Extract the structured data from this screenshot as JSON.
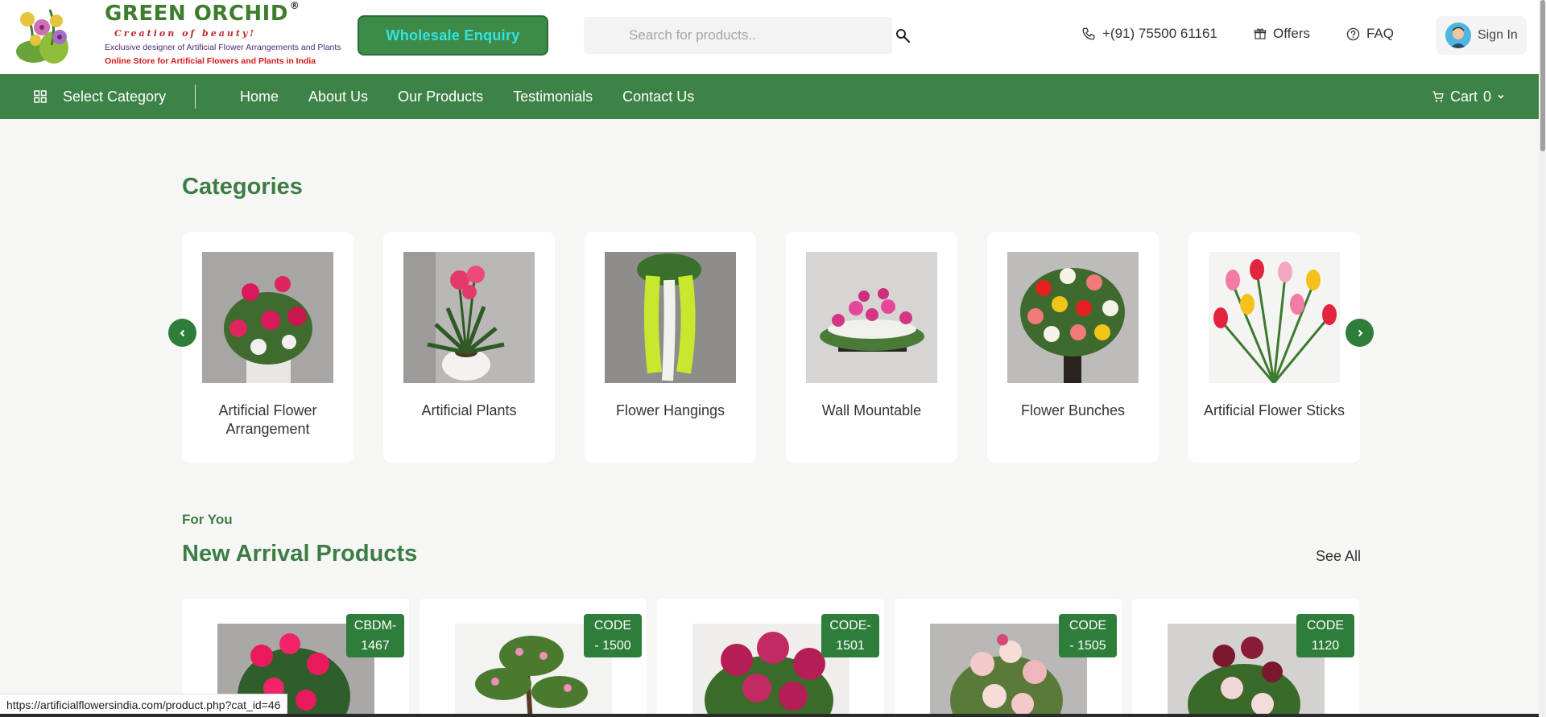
{
  "header": {
    "brand": "GREEN ORCHID",
    "registered": "®",
    "tagline": "Creation of beauty!",
    "sub1": "Exclusive designer of Artificial Flower Arrangements and Plants",
    "sub2": "Online Store for Artificial Flowers and Plants in India",
    "wholesale_label": "Wholesale Enquiry",
    "search_placeholder": "Search for products..",
    "phone": "+(91) 75500 61161",
    "offers": "Offers",
    "faq": "FAQ",
    "signin": "Sign In"
  },
  "nav": {
    "select_category": "Select Category",
    "links": [
      "Home",
      "About Us",
      "Our Products",
      "Testimonials",
      "Contact Us"
    ],
    "cart_label": "Cart",
    "cart_count": "0"
  },
  "categories": {
    "title": "Categories",
    "items": [
      {
        "name": "Artificial Flower Arrangement"
      },
      {
        "name": "Artificial Plants"
      },
      {
        "name": "Flower Hangings"
      },
      {
        "name": "Wall Mountable"
      },
      {
        "name": "Flower Bunches"
      },
      {
        "name": "Artificial Flower Sticks"
      }
    ]
  },
  "new_arrivals": {
    "eyebrow": "For You",
    "title": "New Arrival Products",
    "see_all": "See All",
    "products": [
      {
        "code_line1": "CBDM-",
        "code_line2": "1467"
      },
      {
        "code_line1": "CODE",
        "code_line2": "- 1500"
      },
      {
        "code_line1": "CODE-",
        "code_line2": "1501"
      },
      {
        "code_line1": "CODE",
        "code_line2": "- 1505"
      },
      {
        "code_line1": "CODE",
        "code_line2": "1120"
      }
    ]
  },
  "status_bar": {
    "url": "https://artificialflowersindia.com/product.php?cat_id=46"
  },
  "colors": {
    "brand_green": "#3d8246",
    "heading_green": "#3d7d45",
    "badge_green": "#2e7d3a",
    "wholesale_text": "#35e3e0"
  }
}
